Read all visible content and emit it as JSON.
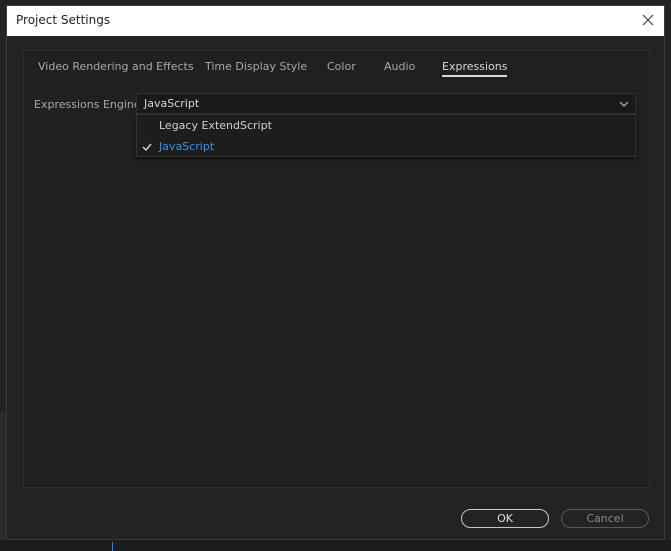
{
  "window": {
    "title": "Project Settings"
  },
  "tabs": [
    {
      "label": "Video Rendering and Effects",
      "active": false
    },
    {
      "label": "Time Display Style",
      "active": false
    },
    {
      "label": "Color",
      "active": false
    },
    {
      "label": "Audio",
      "active": false
    },
    {
      "label": "Expressions",
      "active": true
    }
  ],
  "expressions_engine": {
    "label": "Expressions Engine:",
    "selected": "JavaScript",
    "options": [
      {
        "label": "Legacy ExtendScript",
        "checked": false
      },
      {
        "label": "JavaScript",
        "checked": true
      }
    ]
  },
  "buttons": {
    "ok_label": "OK",
    "cancel_label": "Cancel"
  },
  "colors": {
    "background": "#232323",
    "panel": "#202020",
    "accent_blue": "#3a8ee6",
    "text": "#a8a8a8",
    "text_bright": "#d6d6d6"
  },
  "icons": {
    "close": "close-icon",
    "dropdown": "chevron-down-icon",
    "check": "check-icon"
  }
}
